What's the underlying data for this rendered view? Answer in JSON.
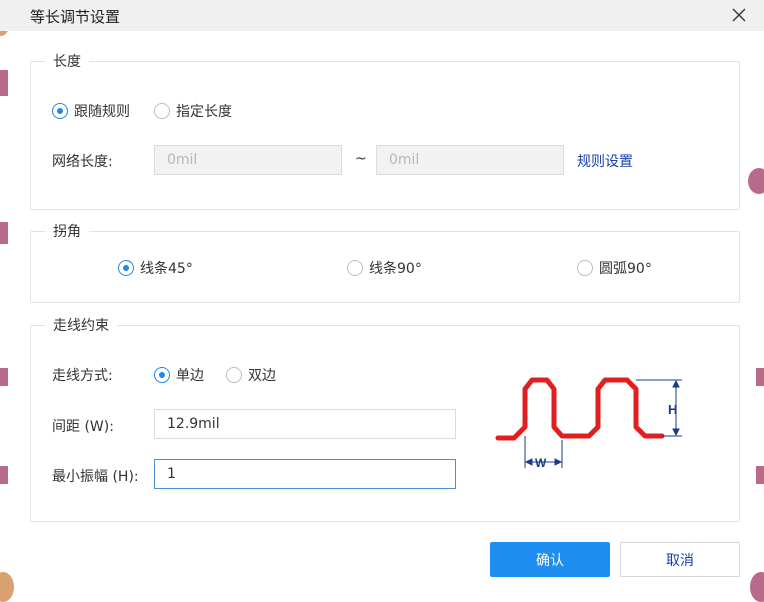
{
  "dialog": {
    "title": "等长调节设置",
    "close_icon": "close-icon"
  },
  "length_group": {
    "legend": "长度",
    "options": [
      "跟随规则",
      "指定长度"
    ],
    "selected": 0,
    "net_length_label": "网络长度:",
    "min_placeholder": "0mil",
    "max_placeholder": "0mil",
    "separator": "~",
    "rule_settings_link": "规则设置"
  },
  "corner_group": {
    "legend": "拐角",
    "options": [
      "线条45°",
      "线条90°",
      "圆弧90°"
    ],
    "selected": 0
  },
  "routing_group": {
    "legend": "走线约束",
    "mode_label": "走线方式:",
    "mode_options": [
      "单边",
      "双边"
    ],
    "mode_selected": 0,
    "spacing_label": "间距 (W):",
    "spacing_value": "12.9mil",
    "amplitude_label": "最小振幅 (H):",
    "amplitude_value": "1",
    "diagram": {
      "height_label": "H",
      "width_label": "W",
      "trace_color": "#e02020",
      "dimension_color": "#1a3a8a"
    }
  },
  "buttons": {
    "confirm": "确认",
    "cancel": "取消"
  },
  "colors": {
    "accent": "#1f8ef1",
    "link": "#1a3faa"
  }
}
